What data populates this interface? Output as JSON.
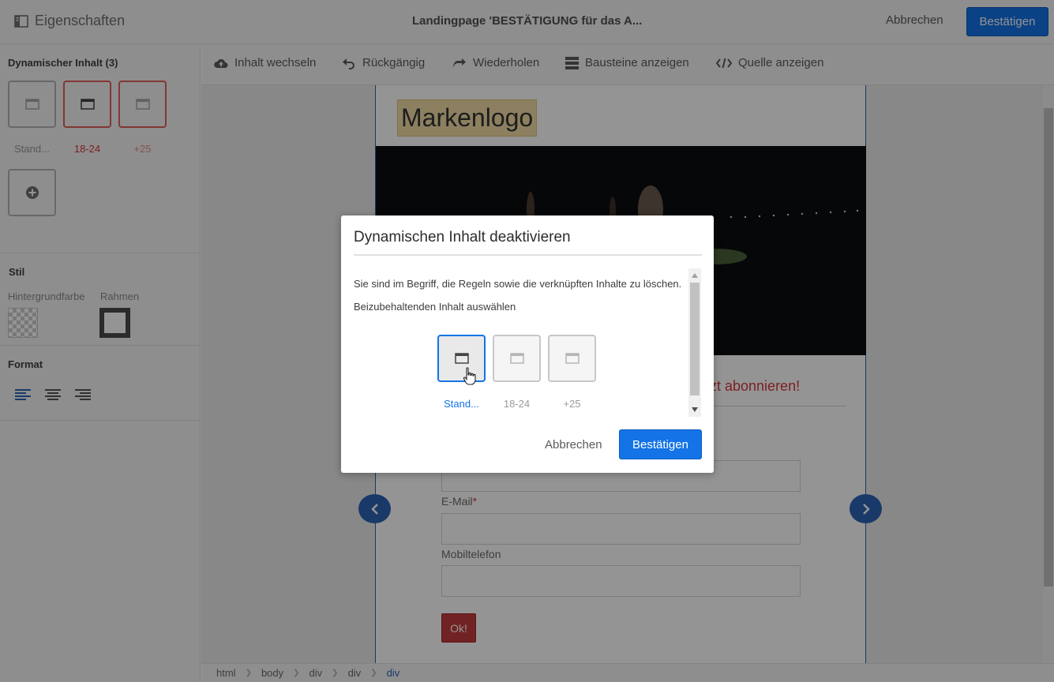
{
  "topbar": {
    "properties_label": "Eigenschaften",
    "title": "Landingpage 'BESTÄTIGUNG für das A...",
    "cancel_label": "Abbrechen",
    "confirm_label": "Bestätigen"
  },
  "leftpanel": {
    "dynamic_heading": "Dynamischer Inhalt (3)",
    "variants": [
      {
        "label": "Stand..."
      },
      {
        "label": "18-24"
      },
      {
        "label": "+25"
      }
    ],
    "style_heading": "Stil",
    "bgcolor_label": "Hintergrundfarbe",
    "border_label": "Rahmen",
    "format_heading": "Format"
  },
  "toolbar": {
    "switch_content": "Inhalt wechseln",
    "undo": "Rückgängig",
    "redo": "Wiederholen",
    "show_blocks": "Bausteine anzeigen",
    "show_source": "Quelle anzeigen"
  },
  "canvas": {
    "logo_text": "Markenlogo",
    "subscribe_text": "zt abonnieren!",
    "email_label": "E-Mail",
    "required_mark": "*",
    "mobile_label": "Mobiltelefon",
    "ok_label": "Ok!"
  },
  "breadcrumb": [
    "html",
    "body",
    "div",
    "div",
    "div"
  ],
  "modal": {
    "title": "Dynamischen Inhalt deaktivieren",
    "text1": "Sie sind im Begriff, die Regeln sowie die verknüpften Inhalte zu löschen.",
    "text2": "Beizubehaltenden Inhalt auswählen",
    "variants": [
      {
        "label": "Stand...",
        "selected": true
      },
      {
        "label": "18-24",
        "selected": false
      },
      {
        "label": "+25",
        "selected": false
      }
    ],
    "cancel_label": "Abbrechen",
    "confirm_label": "Bestätigen"
  },
  "colors": {
    "accent": "#1473e6",
    "danger": "#d7373f",
    "nav_blue": "#2b63b6"
  }
}
